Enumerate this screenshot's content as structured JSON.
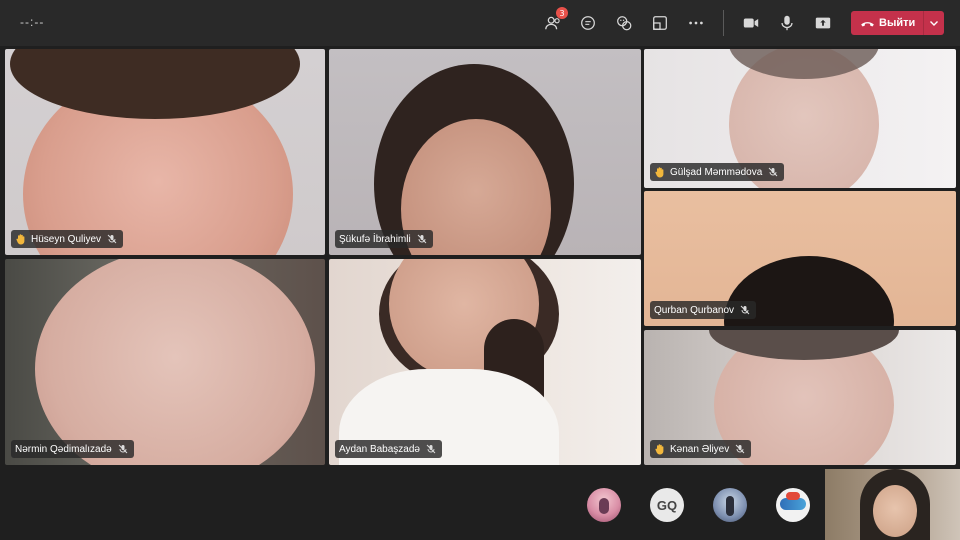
{
  "toolbar": {
    "timer": "--:--",
    "participants_badge": "3",
    "leave_label": "Выйти",
    "icons": [
      "people-icon",
      "chat-icon",
      "reactions-icon",
      "share-tray-icon",
      "more-icon",
      "camera-icon",
      "mic-icon",
      "share-icon",
      "phone-hangup-icon",
      "chevron-down-icon"
    ]
  },
  "participants": [
    {
      "name": "Hüseyn Quliyev",
      "hand_raised": true,
      "muted": true
    },
    {
      "name": "Şükufə İbrahimli",
      "hand_raised": false,
      "muted": true
    },
    {
      "name": "Gülşad Məmmədova",
      "hand_raised": true,
      "muted": true
    },
    {
      "name": "Qurban Qurbanov",
      "hand_raised": false,
      "muted": true
    },
    {
      "name": "Nərmin Qədimalızadə",
      "hand_raised": false,
      "muted": true
    },
    {
      "name": "Aydan Babaşzadə",
      "hand_raised": false,
      "muted": true
    },
    {
      "name": "Kənan Əliyev",
      "hand_raised": true,
      "muted": true
    }
  ],
  "gallery_avatars": [
    {
      "type": "photo"
    },
    {
      "type": "initials",
      "initials": "GQ"
    },
    {
      "type": "photo"
    },
    {
      "type": "photo"
    }
  ],
  "colors": {
    "topbar": "#292929",
    "background": "#1f1f1f",
    "leave": "#c4314b",
    "badge": "#e8514a"
  }
}
